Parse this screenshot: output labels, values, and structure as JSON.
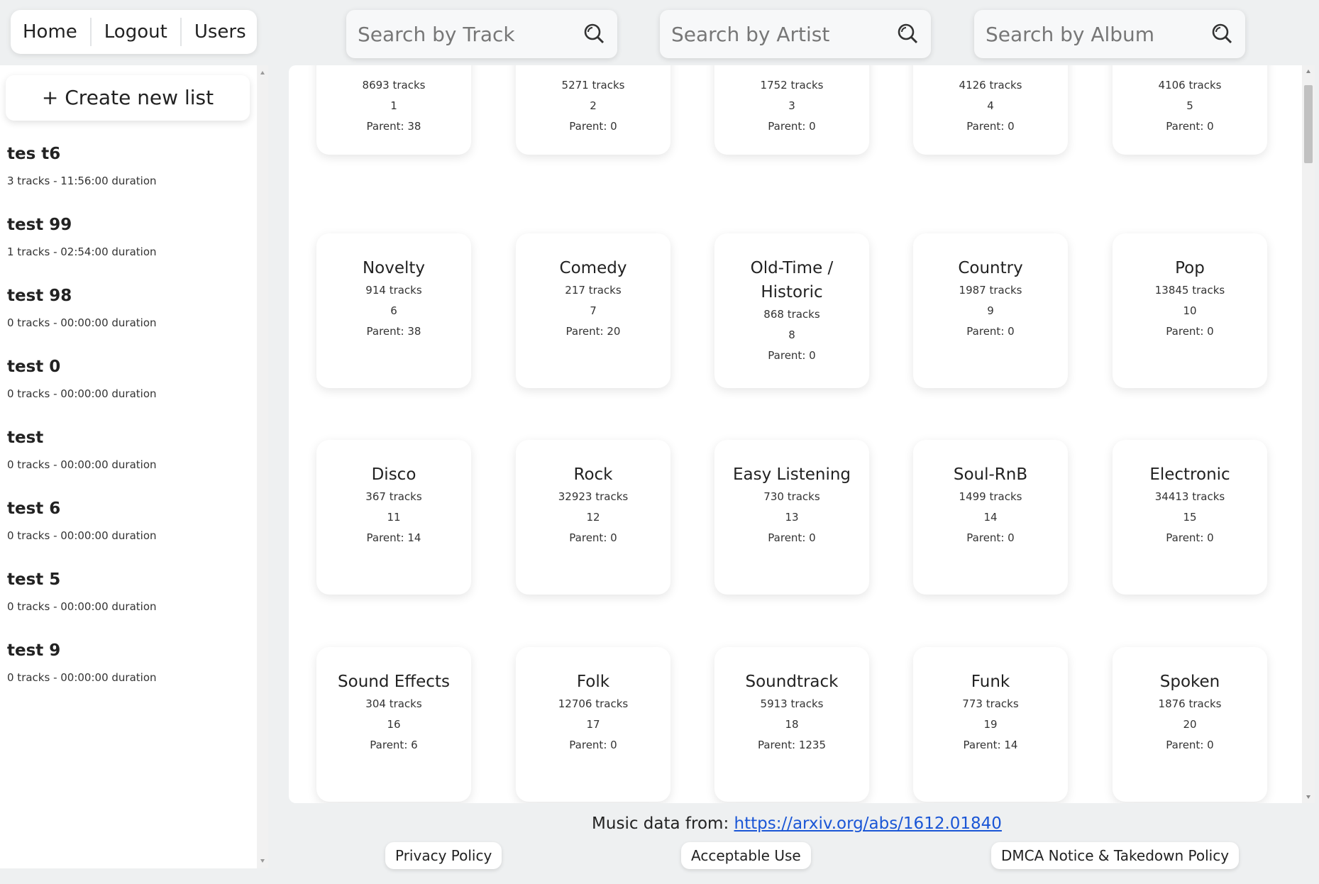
{
  "nav": {
    "home": "Home",
    "logout": "Logout",
    "users": "Users"
  },
  "search": {
    "track_placeholder": "Search by Track",
    "artist_placeholder": "Search by Artist",
    "album_placeholder": "Search by Album"
  },
  "sidebar": {
    "create_label": "+ Create new list",
    "lists": [
      {
        "name": "tes t6",
        "meta": "3 tracks - 11:56:00 duration"
      },
      {
        "name": "test 99",
        "meta": "1 tracks - 02:54:00 duration"
      },
      {
        "name": "test 98",
        "meta": "0 tracks - 00:00:00 duration"
      },
      {
        "name": "test 0",
        "meta": "0 tracks - 00:00:00 duration"
      },
      {
        "name": "test",
        "meta": "0 tracks - 00:00:00 duration"
      },
      {
        "name": "test 6",
        "meta": "0 tracks - 00:00:00 duration"
      },
      {
        "name": "test 5",
        "meta": "0 tracks - 00:00:00 duration"
      },
      {
        "name": "test 9",
        "meta": "0 tracks - 00:00:00 duration"
      }
    ]
  },
  "genres": [
    {
      "title": "",
      "tracks": "8693 tracks",
      "id": "1",
      "parent": "Parent: 38"
    },
    {
      "title": "",
      "tracks": "5271 tracks",
      "id": "2",
      "parent": "Parent: 0"
    },
    {
      "title": "",
      "tracks": "1752 tracks",
      "id": "3",
      "parent": "Parent: 0"
    },
    {
      "title": "",
      "tracks": "4126 tracks",
      "id": "4",
      "parent": "Parent: 0"
    },
    {
      "title": "",
      "tracks": "4106 tracks",
      "id": "5",
      "parent": "Parent: 0"
    },
    {
      "title": "Novelty",
      "tracks": "914 tracks",
      "id": "6",
      "parent": "Parent: 38"
    },
    {
      "title": "Comedy",
      "tracks": "217 tracks",
      "id": "7",
      "parent": "Parent: 20"
    },
    {
      "title": "Old-Time / Historic",
      "tracks": "868 tracks",
      "id": "8",
      "parent": "Parent: 0"
    },
    {
      "title": "Country",
      "tracks": "1987 tracks",
      "id": "9",
      "parent": "Parent: 0"
    },
    {
      "title": "Pop",
      "tracks": "13845 tracks",
      "id": "10",
      "parent": "Parent: 0"
    },
    {
      "title": "Disco",
      "tracks": "367 tracks",
      "id": "11",
      "parent": "Parent: 14"
    },
    {
      "title": "Rock",
      "tracks": "32923 tracks",
      "id": "12",
      "parent": "Parent: 0"
    },
    {
      "title": "Easy Listening",
      "tracks": "730 tracks",
      "id": "13",
      "parent": "Parent: 0"
    },
    {
      "title": "Soul-RnB",
      "tracks": "1499 tracks",
      "id": "14",
      "parent": "Parent: 0"
    },
    {
      "title": "Electronic",
      "tracks": "34413 tracks",
      "id": "15",
      "parent": "Parent: 0"
    },
    {
      "title": "Sound Effects",
      "tracks": "304 tracks",
      "id": "16",
      "parent": "Parent: 6"
    },
    {
      "title": "Folk",
      "tracks": "12706 tracks",
      "id": "17",
      "parent": "Parent: 0"
    },
    {
      "title": "Soundtrack",
      "tracks": "5913 tracks",
      "id": "18",
      "parent": "Parent: 1235"
    },
    {
      "title": "Funk",
      "tracks": "773 tracks",
      "id": "19",
      "parent": "Parent: 14"
    },
    {
      "title": "Spoken",
      "tracks": "1876 tracks",
      "id": "20",
      "parent": "Parent: 0"
    }
  ],
  "footer": {
    "source_label": "Music data from:",
    "source_link": "https://arxiv.org/abs/1612.01840",
    "privacy": "Privacy Policy",
    "acceptable_use": "Acceptable Use",
    "dmca": "DMCA Notice & Takedown Policy"
  },
  "colors": {
    "link": "#1a56d6",
    "background": "#eef0f1"
  },
  "icons": {
    "search": "search-icon"
  }
}
